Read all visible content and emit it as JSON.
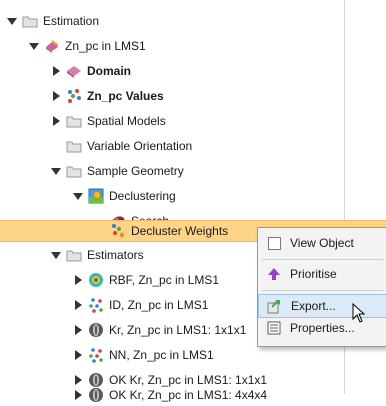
{
  "tree": [
    {
      "label": "Estimation",
      "bold": false,
      "icon": "folder-icon"
    },
    {
      "label": "Zn_pc in LMS1",
      "bold": false,
      "icon": "estimation-domain-icon"
    },
    {
      "label": "Domain",
      "bold": true,
      "icon": "domain-icon"
    },
    {
      "label": "Zn_pc Values",
      "bold": true,
      "icon": "points-values-icon"
    },
    {
      "label": "Spatial Models",
      "bold": false,
      "icon": "folder-icon"
    },
    {
      "label": "Variable Orientation",
      "bold": false,
      "icon": "folder-icon"
    },
    {
      "label": "Sample Geometry",
      "bold": false,
      "icon": "folder-icon"
    },
    {
      "label": "Declustering",
      "bold": false,
      "icon": "declustering-icon"
    },
    {
      "label": "Search",
      "bold": false,
      "icon": "search-ellipsoid-icon"
    },
    {
      "label": "Decluster Weights",
      "bold": false,
      "icon": "decluster-weights-icon"
    },
    {
      "label": "Estimators",
      "bold": false,
      "icon": "folder-icon"
    },
    {
      "label": "RBF, Zn_pc in LMS1",
      "bold": false,
      "icon": "rbf-estimator-icon"
    },
    {
      "label": "ID, Zn_pc in LMS1",
      "bold": false,
      "icon": "id-estimator-icon"
    },
    {
      "label": "Kr, Zn_pc in LMS1: 1x1x1",
      "bold": false,
      "icon": "kriging-estimator-icon"
    },
    {
      "label": "NN, Zn_pc in LMS1",
      "bold": false,
      "icon": "nn-estimator-icon"
    },
    {
      "label": "OK Kr, Zn_pc in LMS1: 1x1x1",
      "bold": false,
      "icon": "kriging-estimator-icon"
    },
    {
      "label": "OK Kr, Zn_pc in LMS1: 4x4x4",
      "bold": false,
      "icon": "kriging-estimator-icon"
    }
  ],
  "context_menu": {
    "view_object": "View Object",
    "prioritise": "Prioritise",
    "export": "Export...",
    "properties": "Properties..."
  },
  "colors": {
    "selection": "#fdd488",
    "folder": "#d8d8d8",
    "menu_hover": "#dbe9f8"
  }
}
